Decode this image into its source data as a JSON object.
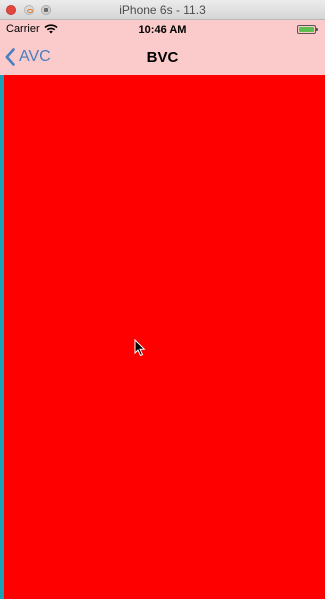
{
  "window": {
    "title": "iPhone 6s - 11.3"
  },
  "status_bar": {
    "carrier": "Carrier",
    "time": "10:46 AM",
    "battery_level": 1.0,
    "icons": [
      "wifi-icon",
      "battery-icon"
    ]
  },
  "nav_bar": {
    "back_label": "AVC",
    "title": "BVC",
    "back_icon": "chevron-left-icon",
    "tint_color": "#4a7fc1",
    "background_color": "#fbcaca"
  },
  "content": {
    "background_color": "#ff0000",
    "edge_color": "#1aa3b8"
  },
  "pointer": {
    "icon": "cursor-icon"
  }
}
